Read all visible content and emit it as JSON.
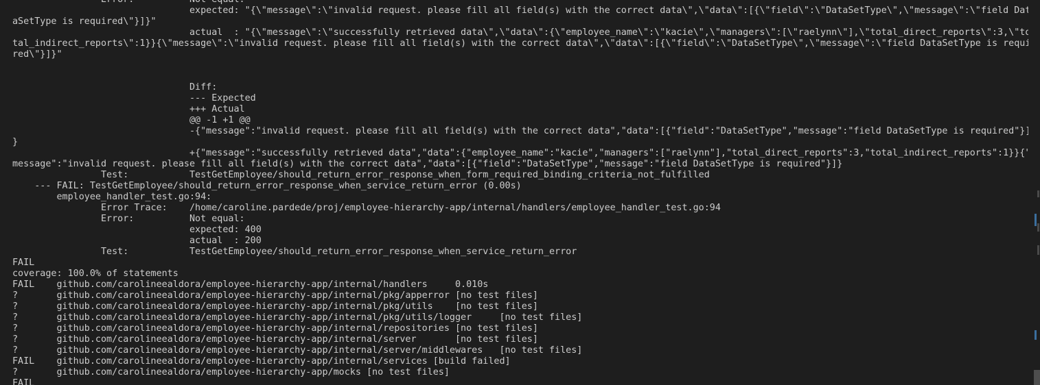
{
  "lines": [
    "                Error:          Not equal:",
    "                                expected: \"{\\\"message\\\":\\\"invalid request. please fill all field(s) with the correct data\\\",\\\"data\\\":[{\\\"field\\\":\\\"DataSetType\\\",\\\"message\\\":\\\"field Dat",
    "aSetType is required\\\"}]}\"",
    "                                actual  : \"{\\\"message\\\":\\\"successfully retrieved data\\\",\\\"data\\\":{\\\"employee_name\\\":\\\"kacie\\\",\\\"managers\\\":[\\\"raelynn\\\"],\\\"total_direct_reports\\\":3,\\\"to",
    "tal_indirect_reports\\\":1}}{\\\"message\\\":\\\"invalid request. please fill all field(s) with the correct data\\\",\\\"data\\\":[{\\\"field\\\":\\\"DataSetType\\\",\\\"message\\\":\\\"field DataSetType is requi",
    "red\\\"}]}\"",
    "",
    "",
    "                                Diff:",
    "                                --- Expected",
    "                                +++ Actual",
    "                                @@ -1 +1 @@",
    "                                -{\"message\":\"invalid request. please fill all field(s) with the correct data\",\"data\":[{\"field\":\"DataSetType\",\"message\":\"field DataSetType is required\"}]",
    "}",
    "                                +{\"message\":\"successfully retrieved data\",\"data\":{\"employee_name\":\"kacie\",\"managers\":[\"raelynn\"],\"total_direct_reports\":3,\"total_indirect_reports\":1}}{\"",
    "message\":\"invalid request. please fill all field(s) with the correct data\",\"data\":[{\"field\":\"DataSetType\",\"message\":\"field DataSetType is required\"}]}",
    "                Test:           TestGetEmployee/should_return_error_response_when_form_required_binding_criteria_not_fulfilled",
    "    --- FAIL: TestGetEmployee/should_return_error_response_when_service_return_error (0.00s)",
    "        employee_handler_test.go:94:",
    "                Error Trace:    /home/caroline.pardede/proj/employee-hierarchy-app/internal/handlers/employee_handler_test.go:94",
    "                Error:          Not equal:",
    "                                expected: 400",
    "                                actual  : 200",
    "                Test:           TestGetEmployee/should_return_error_response_when_service_return_error",
    "FAIL",
    "coverage: 100.0% of statements",
    "FAIL    github.com/carolineealdora/employee-hierarchy-app/internal/handlers     0.010s",
    "?       github.com/carolineealdora/employee-hierarchy-app/internal/pkg/apperror [no test files]",
    "?       github.com/carolineealdora/employee-hierarchy-app/internal/pkg/utils    [no test files]",
    "?       github.com/carolineealdora/employee-hierarchy-app/internal/pkg/utils/logger     [no test files]",
    "?       github.com/carolineealdora/employee-hierarchy-app/internal/repositories [no test files]",
    "?       github.com/carolineealdora/employee-hierarchy-app/internal/server       [no test files]",
    "?       github.com/carolineealdora/employee-hierarchy-app/internal/server/middlewares   [no test files]",
    "FAIL    github.com/carolineealdora/employee-hierarchy-app/internal/services [build failed]",
    "?       github.com/carolineealdora/employee-hierarchy-app/mocks [no test files]",
    "FAIL"
  ],
  "colors": {
    "background": "#1e1e1e",
    "text": "#cccccc",
    "scroll_marker": "#3b6f9e"
  }
}
